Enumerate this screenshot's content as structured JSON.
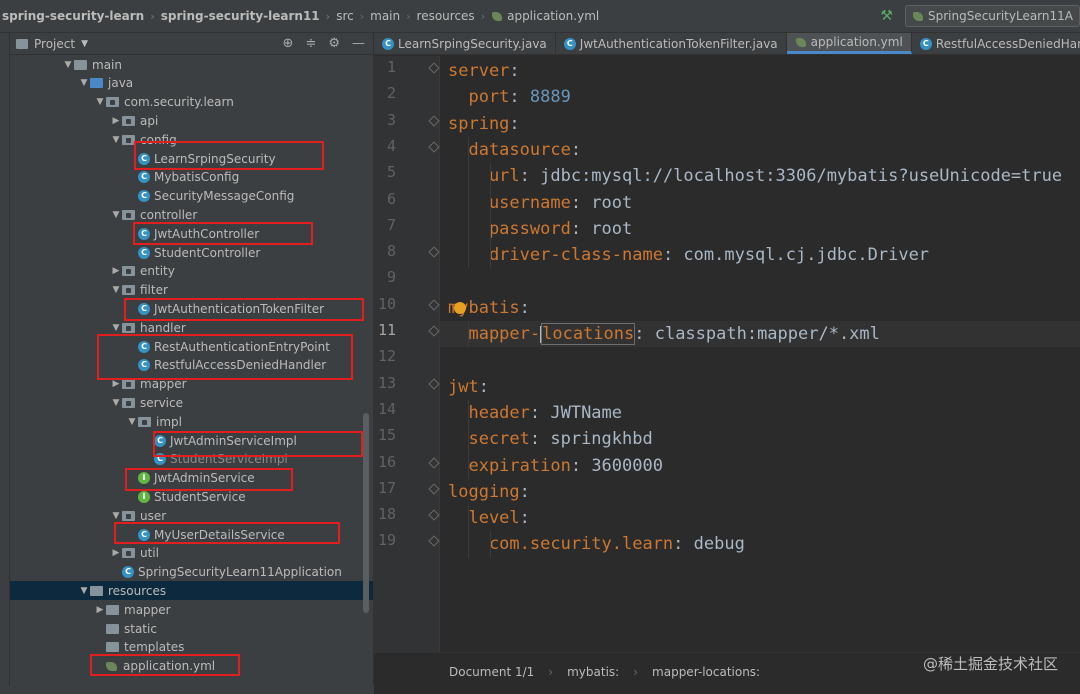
{
  "breadcrumb": {
    "items": [
      "spring-security-learn",
      "spring-security-learn11",
      "src",
      "main",
      "resources",
      "application.yml"
    ]
  },
  "run_config": {
    "label": "SpringSecurityLearn11A"
  },
  "project_panel": {
    "title": "Project"
  },
  "tree": [
    {
      "label": "main",
      "kind": "folder",
      "expanded": true
    },
    {
      "label": "java",
      "kind": "folder-blue",
      "expanded": true
    },
    {
      "label": "com.security.learn",
      "kind": "package",
      "expanded": true
    },
    {
      "label": "api",
      "kind": "package",
      "expanded": false
    },
    {
      "label": "config",
      "kind": "package",
      "expanded": true
    },
    {
      "label": "LearnSrpingSecurity",
      "kind": "class"
    },
    {
      "label": "MybatisConfig",
      "kind": "class"
    },
    {
      "label": "SecurityMessageConfig",
      "kind": "class"
    },
    {
      "label": "controller",
      "kind": "package",
      "expanded": true
    },
    {
      "label": "JwtAuthController",
      "kind": "class"
    },
    {
      "label": "StudentController",
      "kind": "class"
    },
    {
      "label": "entity",
      "kind": "package",
      "expanded": false
    },
    {
      "label": "filter",
      "kind": "package",
      "expanded": true
    },
    {
      "label": "JwtAuthenticationTokenFilter",
      "kind": "class"
    },
    {
      "label": "handler",
      "kind": "package",
      "expanded": true
    },
    {
      "label": "RestAuthenticationEntryPoint",
      "kind": "class"
    },
    {
      "label": "RestfulAccessDeniedHandler",
      "kind": "class"
    },
    {
      "label": "mapper",
      "kind": "package",
      "expanded": false
    },
    {
      "label": "service",
      "kind": "package",
      "expanded": true
    },
    {
      "label": "impl",
      "kind": "package",
      "expanded": true
    },
    {
      "label": "JwtAdminServiceImpl",
      "kind": "class"
    },
    {
      "label": "StudentServiceImpl",
      "kind": "class"
    },
    {
      "label": "JwtAdminService",
      "kind": "interface"
    },
    {
      "label": "StudentService",
      "kind": "interface"
    },
    {
      "label": "user",
      "kind": "package",
      "expanded": true
    },
    {
      "label": "MyUserDetailsService",
      "kind": "class"
    },
    {
      "label": "util",
      "kind": "package",
      "expanded": false
    },
    {
      "label": "SpringSecurityLearn11Application",
      "kind": "spring"
    },
    {
      "label": "resources",
      "kind": "folder",
      "expanded": true,
      "selected": true
    },
    {
      "label": "mapper",
      "kind": "folder",
      "expanded": false
    },
    {
      "label": "static",
      "kind": "folder"
    },
    {
      "label": "templates",
      "kind": "folder"
    },
    {
      "label": "application.yml",
      "kind": "yml"
    }
  ],
  "tabs": [
    {
      "label": "LearnSrpingSecurity.java",
      "icon": "class-icon"
    },
    {
      "label": "JwtAuthenticationTokenFilter.java",
      "icon": "class-icon"
    },
    {
      "label": "application.yml",
      "icon": "yml-icon",
      "active": true
    },
    {
      "label": "RestfulAccessDeniedHan",
      "icon": "class-icon"
    }
  ],
  "editor": {
    "current_line": 11,
    "lines": [
      {
        "n": "1",
        "parts": [
          {
            "t": "server",
            "c": "k"
          },
          {
            "t": ":",
            "c": "v"
          }
        ]
      },
      {
        "n": "2",
        "parts": [
          {
            "t": "  port",
            "c": "k"
          },
          {
            "t": ": ",
            "c": "v"
          },
          {
            "t": "8889",
            "c": "num"
          }
        ]
      },
      {
        "n": "3",
        "parts": [
          {
            "t": "spring",
            "c": "k"
          },
          {
            "t": ":",
            "c": "v"
          }
        ]
      },
      {
        "n": "4",
        "parts": [
          {
            "t": "  datasource",
            "c": "k"
          },
          {
            "t": ":",
            "c": "v"
          }
        ]
      },
      {
        "n": "5",
        "parts": [
          {
            "t": "    url",
            "c": "k"
          },
          {
            "t": ": jdbc:mysql://localhost:3306/mybatis?useUnicode=true",
            "c": "v"
          }
        ]
      },
      {
        "n": "6",
        "parts": [
          {
            "t": "    username",
            "c": "k"
          },
          {
            "t": ": root",
            "c": "v"
          }
        ]
      },
      {
        "n": "7",
        "parts": [
          {
            "t": "    password",
            "c": "k"
          },
          {
            "t": ": root",
            "c": "v"
          }
        ]
      },
      {
        "n": "8",
        "parts": [
          {
            "t": "    driver-class-name",
            "c": "k"
          },
          {
            "t": ": com.mysql.cj.jdbc.Driver",
            "c": "v"
          }
        ]
      },
      {
        "n": "9",
        "parts": []
      },
      {
        "n": "10",
        "parts": [
          {
            "t": "mybatis",
            "c": "k"
          },
          {
            "t": ":",
            "c": "v"
          }
        ]
      },
      {
        "n": "11",
        "parts": [
          {
            "t": "  mapper-locations",
            "c": "k"
          },
          {
            "t": ": classpath:mapper/*.xml",
            "c": "v"
          }
        ]
      },
      {
        "n": "12",
        "parts": []
      },
      {
        "n": "13",
        "parts": [
          {
            "t": "jwt",
            "c": "k"
          },
          {
            "t": ":",
            "c": "v"
          }
        ]
      },
      {
        "n": "14",
        "parts": [
          {
            "t": "  header",
            "c": "k"
          },
          {
            "t": ": JWTName",
            "c": "v"
          }
        ]
      },
      {
        "n": "15",
        "parts": [
          {
            "t": "  secret",
            "c": "k"
          },
          {
            "t": ": springkhbd",
            "c": "v"
          }
        ]
      },
      {
        "n": "16",
        "parts": [
          {
            "t": "  expiration",
            "c": "k"
          },
          {
            "t": ": ",
            "c": "v"
          },
          {
            "t": "3600000",
            "c": "v"
          }
        ]
      },
      {
        "n": "17",
        "parts": [
          {
            "t": "logging",
            "c": "k"
          },
          {
            "t": ":",
            "c": "v"
          }
        ]
      },
      {
        "n": "18",
        "parts": [
          {
            "t": "  level",
            "c": "k"
          },
          {
            "t": ":",
            "c": "v"
          }
        ]
      },
      {
        "n": "19",
        "parts": [
          {
            "t": "    com.security.learn",
            "c": "k"
          },
          {
            "t": ": debug",
            "c": "v"
          }
        ]
      }
    ]
  },
  "statusbar": {
    "items": [
      "Document 1/1",
      "mybatis:",
      "mapper-locations:"
    ],
    "watermark": "@稀土掘金技术社区"
  },
  "colors": {
    "highlight": "#e11f1f",
    "keyword": "#cc7832",
    "number": "#6897bb",
    "accent": "#4a88c7"
  }
}
